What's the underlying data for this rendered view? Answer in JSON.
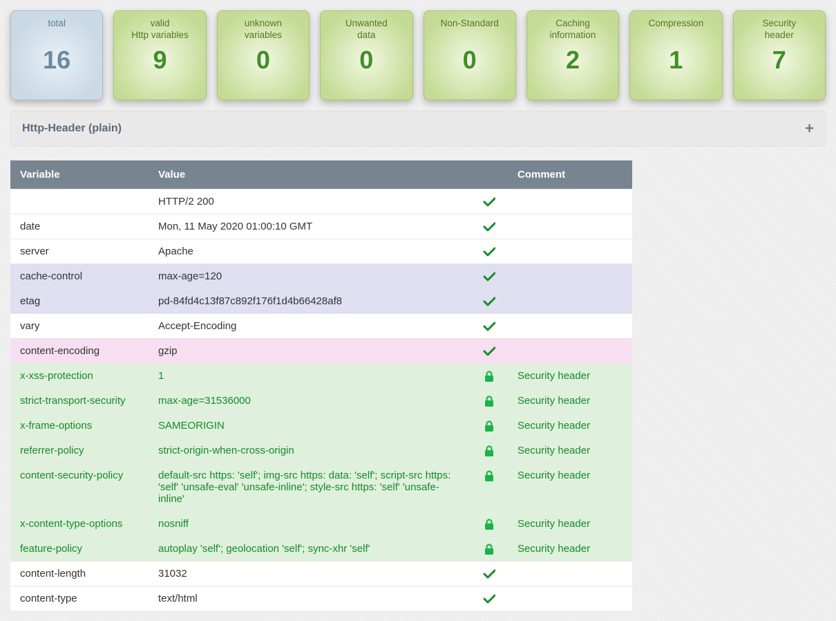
{
  "cards": [
    {
      "label": "total",
      "value": "16",
      "style": "blue"
    },
    {
      "label": "valid\nHttp variables",
      "value": "9",
      "style": "green"
    },
    {
      "label": "unknown\nvariables",
      "value": "0",
      "style": "green"
    },
    {
      "label": "Unwanted\ndata",
      "value": "0",
      "style": "green"
    },
    {
      "label": "Non-Standard",
      "value": "0",
      "style": "green"
    },
    {
      "label": "Caching information",
      "value": "2",
      "style": "green"
    },
    {
      "label": "Compression",
      "value": "1",
      "style": "green"
    },
    {
      "label": "Security\nheader",
      "value": "7",
      "style": "green"
    }
  ],
  "panel": {
    "title": "Http-Header (plain)",
    "expand": "+"
  },
  "table": {
    "headers": {
      "variable": "Variable",
      "value": "Value",
      "comment": "Comment"
    },
    "rows": [
      {
        "variable": "",
        "value": "HTTP/2 200",
        "icon": "check",
        "comment": "",
        "cls": "plain"
      },
      {
        "variable": "date",
        "value": "Mon, 11 May 2020 01:00:10 GMT",
        "icon": "check",
        "comment": "",
        "cls": "plain"
      },
      {
        "variable": "server",
        "value": "Apache",
        "icon": "check",
        "comment": "",
        "cls": "plain"
      },
      {
        "variable": "cache-control",
        "value": "max-age=120",
        "icon": "check",
        "comment": "",
        "cls": "cache"
      },
      {
        "variable": "etag",
        "value": "pd-84fd4c13f87c892f176f1d4b66428af8",
        "icon": "check",
        "comment": "",
        "cls": "cache"
      },
      {
        "variable": "vary",
        "value": "Accept-Encoding",
        "icon": "check",
        "comment": "",
        "cls": "plain"
      },
      {
        "variable": "content-encoding",
        "value": "gzip",
        "icon": "check",
        "comment": "",
        "cls": "comp"
      },
      {
        "variable": "x-xss-protection",
        "value": "1",
        "icon": "lock",
        "comment": "Security header",
        "cls": "sec"
      },
      {
        "variable": "strict-transport-security",
        "value": "max-age=31536000",
        "icon": "lock",
        "comment": "Security header",
        "cls": "sec"
      },
      {
        "variable": "x-frame-options",
        "value": "SAMEORIGIN",
        "icon": "lock",
        "comment": "Security header",
        "cls": "sec"
      },
      {
        "variable": "referrer-policy",
        "value": "strict-origin-when-cross-origin",
        "icon": "lock",
        "comment": "Security header",
        "cls": "sec"
      },
      {
        "variable": "content-security-policy",
        "value": "default-src https: 'self'; img-src https: data: 'self'; script-src https: 'self' 'unsafe-eval' 'unsafe-inline'; style-src https: 'self' 'unsafe-inline'",
        "icon": "lock",
        "comment": "Security header",
        "cls": "sec"
      },
      {
        "variable": "x-content-type-options",
        "value": "nosniff",
        "icon": "lock",
        "comment": "Security header",
        "cls": "sec"
      },
      {
        "variable": "feature-policy",
        "value": "autoplay 'self'; geolocation 'self'; sync-xhr 'self'",
        "icon": "lock",
        "comment": "Security header",
        "cls": "sec"
      },
      {
        "variable": "content-length",
        "value": "31032",
        "icon": "check",
        "comment": "",
        "cls": "plain"
      },
      {
        "variable": "content-type",
        "value": "text/html",
        "icon": "check",
        "comment": "",
        "cls": "plain"
      }
    ]
  }
}
